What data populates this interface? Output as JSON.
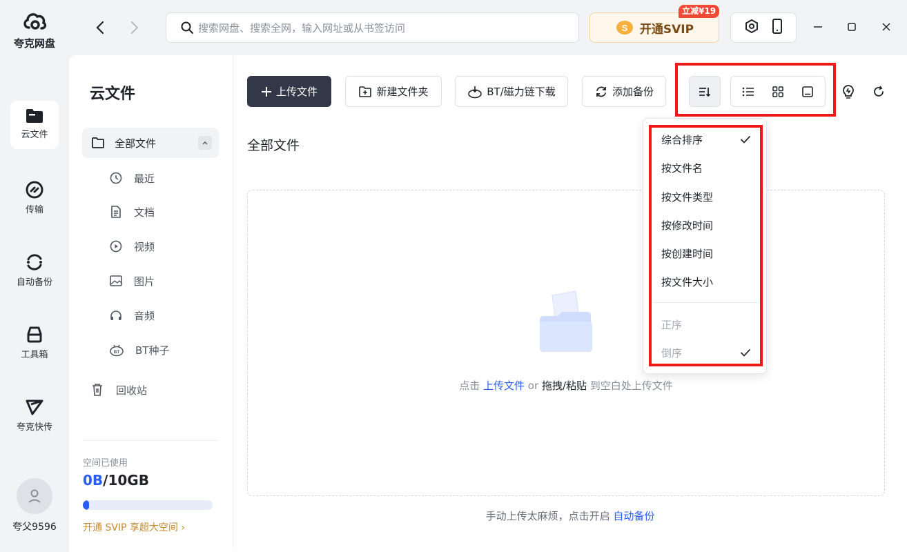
{
  "app": {
    "name": "夸克网盘"
  },
  "rail": {
    "items": [
      {
        "label": "云文件",
        "icon": "folder-icon",
        "active": true
      },
      {
        "label": "传输",
        "icon": "transfer-icon",
        "active": false
      },
      {
        "label": "自动备份",
        "icon": "backup-icon",
        "active": false
      },
      {
        "label": "工具箱",
        "icon": "toolbox-icon",
        "active": false
      },
      {
        "label": "夸克快传",
        "icon": "send-icon",
        "active": false
      }
    ],
    "user": {
      "name": "夸父9596"
    }
  },
  "topbar": {
    "search_placeholder": "搜索网盘、搜索全网，输入网址或从书签访问",
    "svip_label": "开通SVIP",
    "svip_badge": "立减¥19"
  },
  "sidebar": {
    "title": "云文件",
    "all_files": "全部文件",
    "categories": [
      {
        "label": "最近",
        "icon": "clock-icon"
      },
      {
        "label": "文档",
        "icon": "document-icon"
      },
      {
        "label": "视频",
        "icon": "video-icon"
      },
      {
        "label": "图片",
        "icon": "image-icon"
      },
      {
        "label": "音频",
        "icon": "headphones-icon"
      },
      {
        "label": "BT种子",
        "icon": "bt-icon"
      }
    ],
    "trash": "回收站",
    "storage": {
      "label": "空间已使用",
      "used": "0B",
      "total": "/10GB",
      "used_fraction": 0.0,
      "upsell": "开通 SVIP 享超大空间"
    }
  },
  "toolbar": {
    "upload": "上传文件",
    "new_folder": "新建文件夹",
    "bt_download": "BT/磁力链下载",
    "add_backup": "添加备份"
  },
  "content": {
    "breadcrumb": "全部文件",
    "empty": {
      "prefix": "点击",
      "upload_link": "上传文件",
      "or": "or",
      "drag": "拖拽/粘贴",
      "suffix": "到空白处上传文件"
    },
    "footer": {
      "text": "手动上传太麻烦，点击开启",
      "link": "自动备份"
    }
  },
  "sort_menu": {
    "options": [
      {
        "label": "综合排序",
        "checked": true,
        "disabled": false
      },
      {
        "label": "按文件名",
        "checked": false,
        "disabled": false
      },
      {
        "label": "按文件类型",
        "checked": false,
        "disabled": false
      },
      {
        "label": "按修改时间",
        "checked": false,
        "disabled": false
      },
      {
        "label": "按创建时间",
        "checked": false,
        "disabled": false
      },
      {
        "label": "按文件大小",
        "checked": false,
        "disabled": false
      }
    ],
    "order": [
      {
        "label": "正序",
        "checked": false,
        "disabled": true
      },
      {
        "label": "倒序",
        "checked": true,
        "disabled": true
      }
    ]
  },
  "colors": {
    "accent": "#2a5cf6",
    "primary_button": "#333848",
    "highlight": "#f01818",
    "svip_text": "#7a4a14"
  }
}
